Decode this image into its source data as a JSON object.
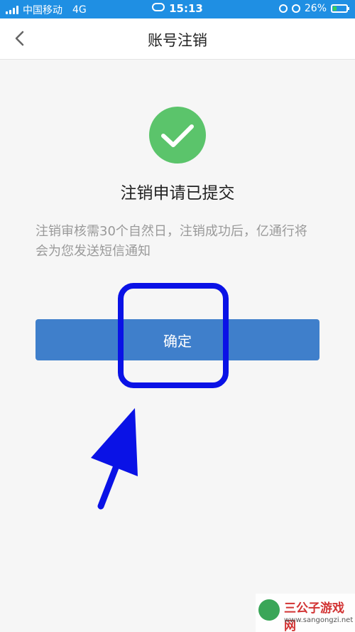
{
  "status_bar": {
    "carrier": "中国移动",
    "network": "4G",
    "time": "15:13",
    "battery": "26%",
    "battery_level": 0.26
  },
  "nav": {
    "title": "账号注销"
  },
  "result": {
    "title": "注销申请已提交",
    "description": "注销审核需30个自然日，注销成功后，亿通行将会为您发送短信通知"
  },
  "buttons": {
    "confirm_label": "确定"
  },
  "colors": {
    "status_bar": "#1f8fe3",
    "success_green": "#5bc46b",
    "button_blue": "#3f7fcb",
    "annotation_blue": "#0a12e6"
  },
  "watermark": {
    "name": "三公子游戏网",
    "url": "www.sangongzi.net"
  }
}
